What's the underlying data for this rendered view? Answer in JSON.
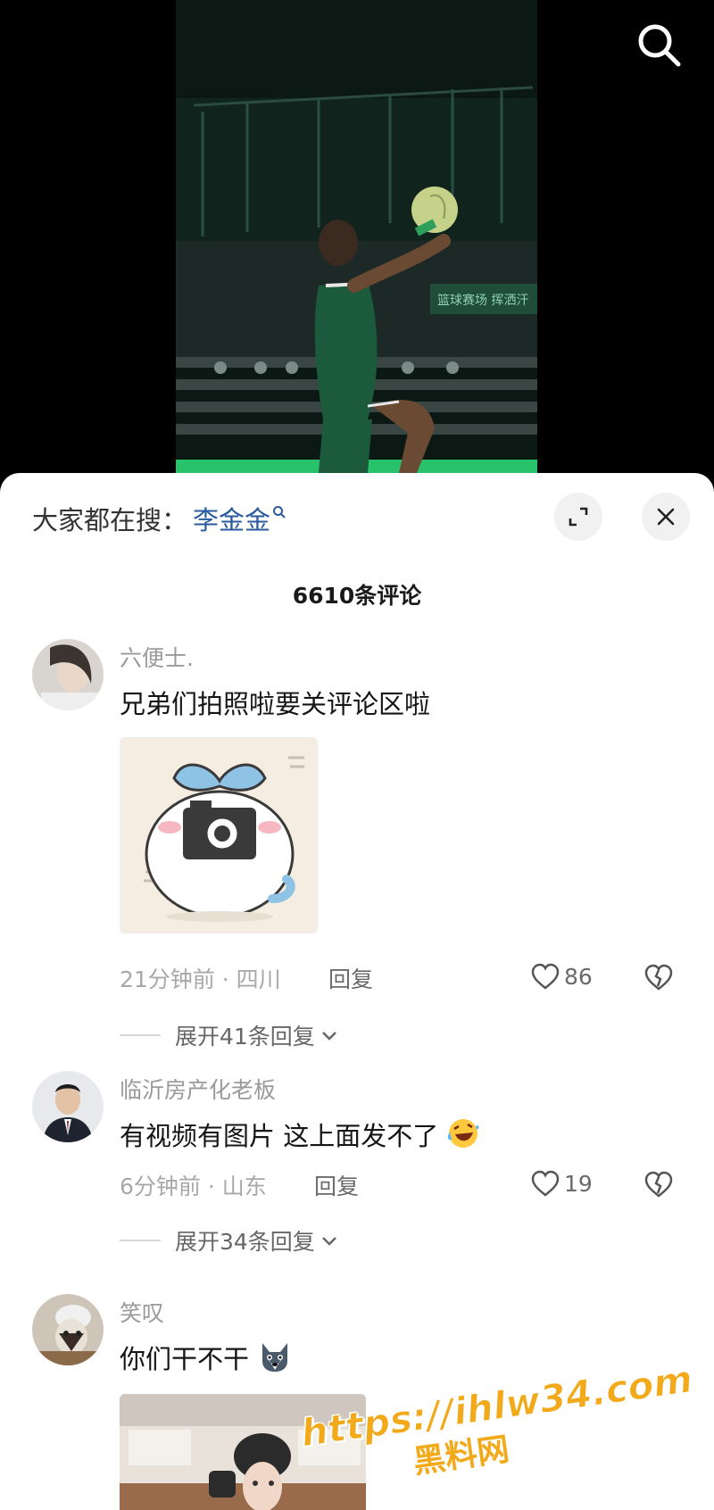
{
  "colors": {
    "trend_link": "#2a5a9e",
    "sheet_bg": "#ffffff",
    "watermark": "#f2a91a"
  },
  "video": {
    "search_icon": "search-icon"
  },
  "sheet": {
    "trend_prefix": "大家都在搜：",
    "trend_term": "李金金",
    "trend_icon": "search-small-icon",
    "expand_icon": "expand-icon",
    "close_icon": "close-icon",
    "comment_count": "6610条评论"
  },
  "comments": [
    {
      "user": "六便士.",
      "text": "兄弟们拍照啦要关评论区啦",
      "time_location": "21分钟前 · 四川",
      "reply_label": "回复",
      "likes": "86",
      "expand_label": "展开41条回复"
    },
    {
      "user": "临沂房产化老板",
      "text": "有视频有图片 这上面发不了",
      "time_location": "6分钟前 · 山东",
      "reply_label": "回复",
      "likes": "19",
      "expand_label": "展开34条回复"
    },
    {
      "user": "笑叹",
      "text": "你们干不干"
    }
  ],
  "watermark": {
    "line1": "https://ihlw34.com",
    "line2": "黑料网"
  }
}
